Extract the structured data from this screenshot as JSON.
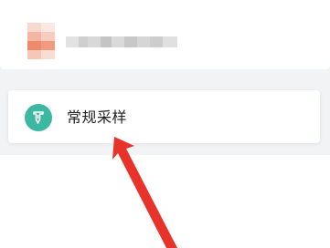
{
  "header": {
    "brand_logo": "pixelated-logo",
    "account_name_blurred": true
  },
  "menu": {
    "items": [
      {
        "label": "常规采样",
        "icon": "sampling-tube-icon",
        "icon_color": "#3cb8a0"
      }
    ]
  },
  "annotation": {
    "arrow_color": "#e8332b"
  }
}
